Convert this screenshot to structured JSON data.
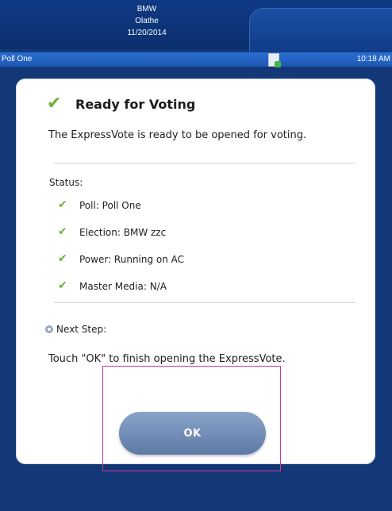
{
  "header": {
    "line1": "BMW",
    "line2": "Olathe",
    "date": "11/20/2014"
  },
  "status_bar": {
    "poll_name": "Poll One",
    "time": "10:18 AM"
  },
  "dialog": {
    "title": "Ready for Voting",
    "subtitle": "The ExpressVote is ready to be opened for voting.",
    "status_label": "Status:",
    "status_items": [
      "Poll: Poll One",
      "Election:  BMW zzc",
      "Power: Running on AC",
      "Master Media: N/A"
    ],
    "next_step_label": "Next Step:",
    "instruction": "Touch \"OK\" to finish opening the ExpressVote.",
    "ok_label": "OK"
  },
  "colors": {
    "background": "#123877",
    "status_bar": "#2a6ed0",
    "check": "#6ab33a",
    "button": "#5d7aa7",
    "highlight_outline": "#d13a8e"
  },
  "icons": {
    "check": "check-icon",
    "next_step": "gear-icon",
    "status_bar_document": "document-icon"
  }
}
